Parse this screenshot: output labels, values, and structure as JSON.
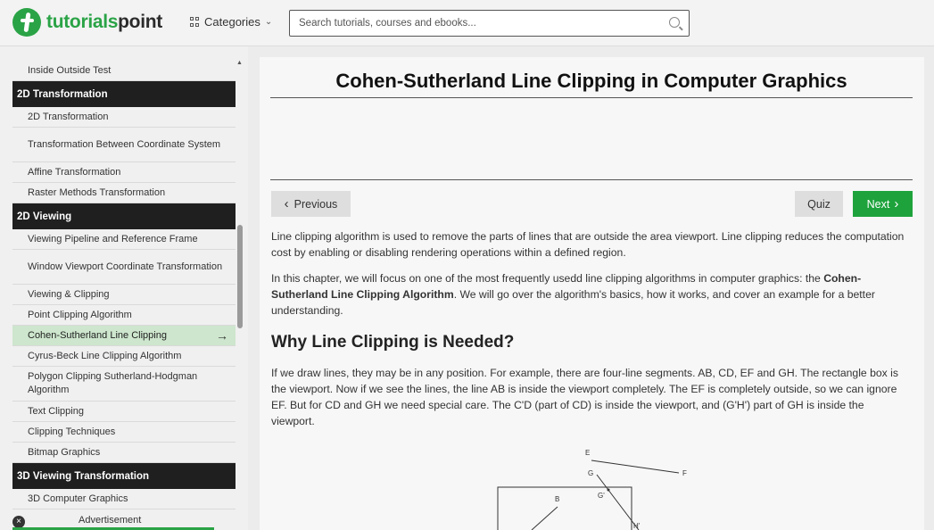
{
  "header": {
    "logo_text_1": "tutorials",
    "logo_text_2": "point",
    "categories_label": "Categories",
    "search_placeholder": "Search tutorials, courses and ebooks..."
  },
  "sidebar": {
    "items": [
      {
        "type": "item",
        "label": "Inside Outside Test"
      },
      {
        "type": "section",
        "label": "2D Transformation"
      },
      {
        "type": "item",
        "label": "2D Transformation"
      },
      {
        "type": "item",
        "label": "Transformation Between Coordinate System",
        "tall": true
      },
      {
        "type": "item",
        "label": "Affine Transformation"
      },
      {
        "type": "item",
        "label": "Raster Methods Transformation"
      },
      {
        "type": "section",
        "label": "2D Viewing"
      },
      {
        "type": "item",
        "label": "Viewing Pipeline and Reference Frame"
      },
      {
        "type": "item",
        "label": "Window Viewport Coordinate Transformation",
        "tall": true
      },
      {
        "type": "item",
        "label": "Viewing & Clipping"
      },
      {
        "type": "item",
        "label": "Point Clipping Algorithm"
      },
      {
        "type": "item",
        "label": "Cohen-Sutherland Line Clipping",
        "active": true
      },
      {
        "type": "item",
        "label": "Cyrus-Beck Line Clipping Algorithm"
      },
      {
        "type": "item",
        "label": "Polygon Clipping Sutherland-Hodgman Algorithm",
        "tall": true
      },
      {
        "type": "item",
        "label": "Text Clipping"
      },
      {
        "type": "item",
        "label": "Clipping Techniques"
      },
      {
        "type": "item",
        "label": "Bitmap Graphics"
      },
      {
        "type": "section",
        "label": "3D Viewing Transformation"
      },
      {
        "type": "item",
        "label": "3D Computer Graphics"
      }
    ],
    "ad_label": "Advertisement"
  },
  "main": {
    "title": "Cohen-Sutherland Line Clipping in Computer Graphics",
    "prev_label": "Previous",
    "quiz_label": "Quiz",
    "next_label": "Next",
    "intro_1": "Line clipping algorithm is used to remove the parts of lines that are outside the area viewport. Line clipping reduces the computation cost by enabling or disabling rendering operations within a defined region.",
    "intro_2_a": "In this chapter, we will focus on one of the most frequently usedd line clipping algorithms in computer graphics: the ",
    "intro_2_bold": "Cohen-Sutherland Line Clipping Algorithm",
    "intro_2_b": ". We will go over the algorithm's basics, how it works, and cover an example for a better understanding.",
    "section_heading": "Why Line Clipping is Needed?",
    "body_1": "If we draw lines, they may be in any position. For example, there are four-line segments. AB, CD, EF and GH. The rectangle box is the viewport. Now if we see the lines, the line AB is inside the viewport completely. The EF is completely outside, so we can ignore EF. But for CD and GH we need special care. The C'D (part of CD) is inside the viewport, and (G'H') part of GH is inside the viewport.",
    "diagram_labels": {
      "E": "E",
      "F": "F",
      "G": "G",
      "G_prime": "G'",
      "B": "B",
      "H_prime": "H'"
    }
  }
}
